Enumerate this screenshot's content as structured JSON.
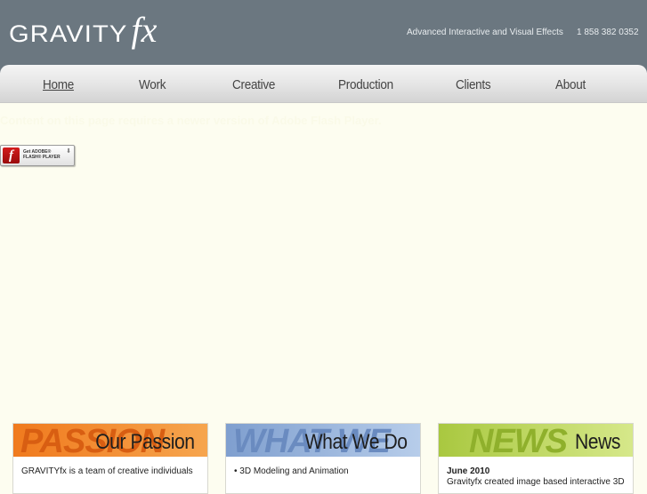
{
  "header": {
    "logo_main": "GRAVITY",
    "logo_fx": "fx",
    "tagline": "Advanced Interactive and Visual Effects",
    "phone": "1 858 382 0352"
  },
  "nav": {
    "items": [
      {
        "label": "Home",
        "active": true
      },
      {
        "label": "Work"
      },
      {
        "label": "Creative"
      },
      {
        "label": "Production"
      },
      {
        "label": "Clients"
      },
      {
        "label": "About"
      }
    ]
  },
  "flash": {
    "missing_text": "Content on this page requires a newer version of Adobe Flash Player.",
    "button_line1": "Get ADOBE®",
    "button_line2": "FLASH® PLAYER",
    "button_letter": "f"
  },
  "panels": {
    "passion": {
      "ghost": "PASSION",
      "title": "Our Passion",
      "body": "GRAVITYfx is a team of creative individuals",
      "colors": {
        "header_start": "#f07a1e",
        "header_end": "#f6a54e",
        "ghost": "#d85e12"
      }
    },
    "whatwedo": {
      "ghost": "WHAT WE",
      "title": "What We Do",
      "body": "• 3D Modeling and Animation",
      "colors": {
        "header_start": "#7f9fcf",
        "header_end": "#b7cdea",
        "ghost": "#6a8bc0"
      }
    },
    "news": {
      "ghost": "NEWS",
      "title": "News",
      "date": "June 2010",
      "body": "Gravityfx created image based interactive 3D",
      "colors": {
        "header_start": "#a9c840",
        "header_end": "#d6e88a",
        "ghost": "#8fb02c"
      }
    }
  }
}
